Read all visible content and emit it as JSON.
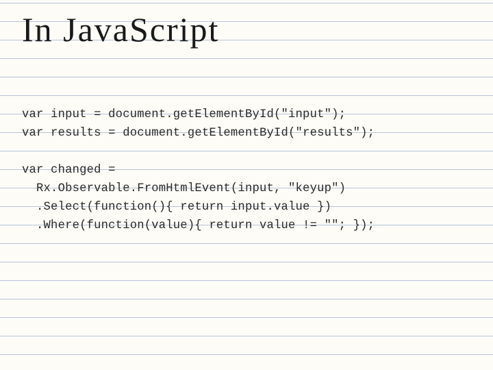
{
  "slide": {
    "title": "In JavaScript",
    "code_block_1": "var input = document.getElementById(\"input\");\nvar results = document.getElementById(\"results\");",
    "code_block_2": "var changed =\n  Rx.Observable.FromHtmlEvent(input, \"keyup\")\n  .Select(function(){ return input.value })\n  .Where(function(value){ return value != \"\"; });"
  }
}
